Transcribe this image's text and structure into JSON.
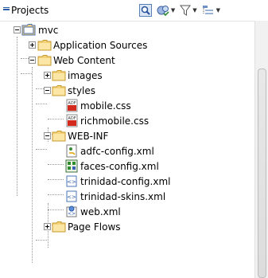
{
  "header": {
    "title": "Projects",
    "tools": [
      "zoom-icon",
      "working-sets-icon",
      "filter-icon",
      "view-menu-icon"
    ]
  },
  "tree": [
    {
      "label": "mvc",
      "icon": "project-folder-icon",
      "expander": "minus",
      "level": 0
    },
    {
      "label": "Application Sources",
      "icon": "folder-icon",
      "expander": "plus",
      "level": 1
    },
    {
      "label": "Web Content",
      "icon": "folder-icon",
      "expander": "minus",
      "level": 1
    },
    {
      "label": "images",
      "icon": "folder-icon",
      "expander": "plus",
      "level": 2
    },
    {
      "label": "styles",
      "icon": "folder-icon",
      "expander": "minus",
      "level": 2
    },
    {
      "label": "mobile.css",
      "icon": "css-file-icon",
      "expander": "none",
      "level": 3
    },
    {
      "label": "richmobile.css",
      "icon": "css-file-icon",
      "expander": "none",
      "level": 3
    },
    {
      "label": "WEB-INF",
      "icon": "folder-icon",
      "expander": "minus",
      "level": 2
    },
    {
      "label": "adfc-config.xml",
      "icon": "adfc-config-icon",
      "expander": "none",
      "level": 3
    },
    {
      "label": "faces-config.xml",
      "icon": "faces-config-icon",
      "expander": "none",
      "level": 3
    },
    {
      "label": "trinidad-config.xml",
      "icon": "xml-file-icon",
      "expander": "none",
      "level": 3
    },
    {
      "label": "trinidad-skins.xml",
      "icon": "xml-file-icon",
      "expander": "none",
      "level": 3
    },
    {
      "label": "web.xml",
      "icon": "web-xml-icon",
      "expander": "none",
      "level": 3
    },
    {
      "label": "Page Flows",
      "icon": "folder-icon",
      "expander": "plus",
      "level": 2
    }
  ],
  "colors": {
    "folder": "#f4d27a",
    "folder_edge": "#c79a2c",
    "css_red": "#d42a1e",
    "tree_line": "#9a9a9a"
  }
}
